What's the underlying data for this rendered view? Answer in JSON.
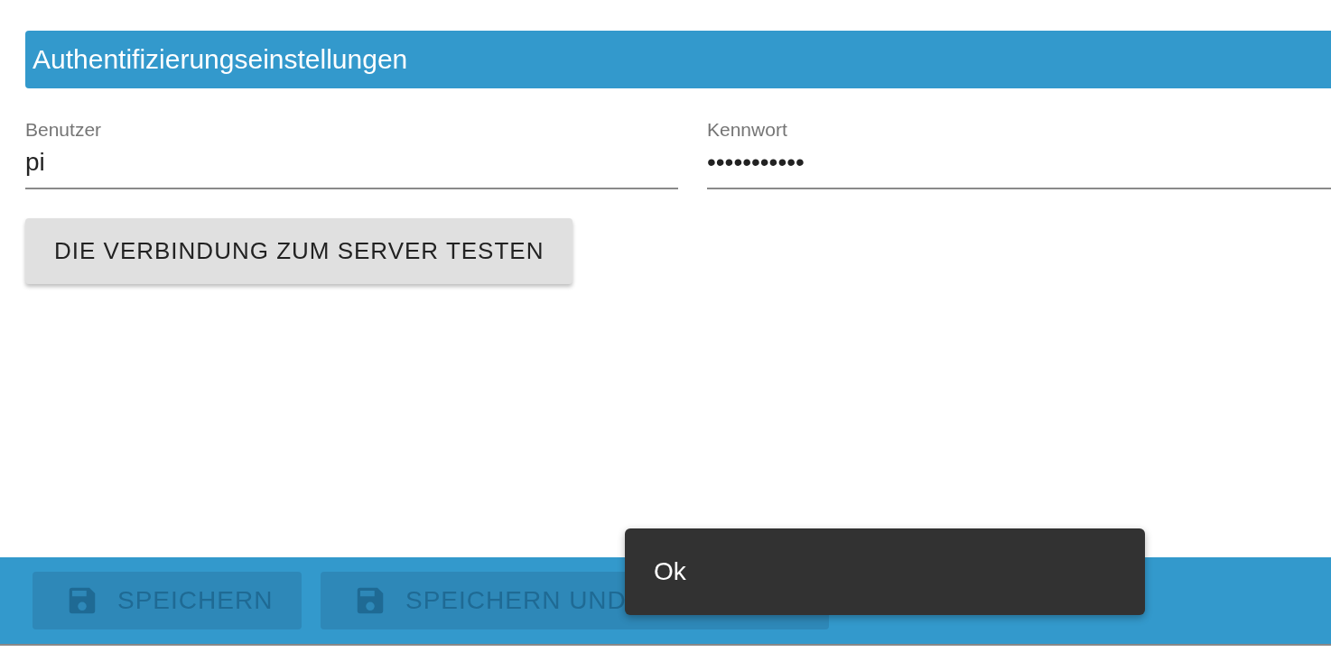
{
  "section": {
    "title": "Authentifizierungseinstellungen"
  },
  "fields": [
    {
      "label": "Benutzer",
      "value": "pi"
    },
    {
      "label": "Kennwort",
      "value": "•••••••••••"
    }
  ],
  "test_button": {
    "label": "DIE VERBINDUNG ZUM SERVER TESTEN"
  },
  "footer_buttons": [
    {
      "label": "SPEICHERN",
      "disabled": true
    },
    {
      "label": "SPEICHERN UND",
      "disabled": true
    }
  ],
  "snackbar": {
    "message": "Ok"
  }
}
